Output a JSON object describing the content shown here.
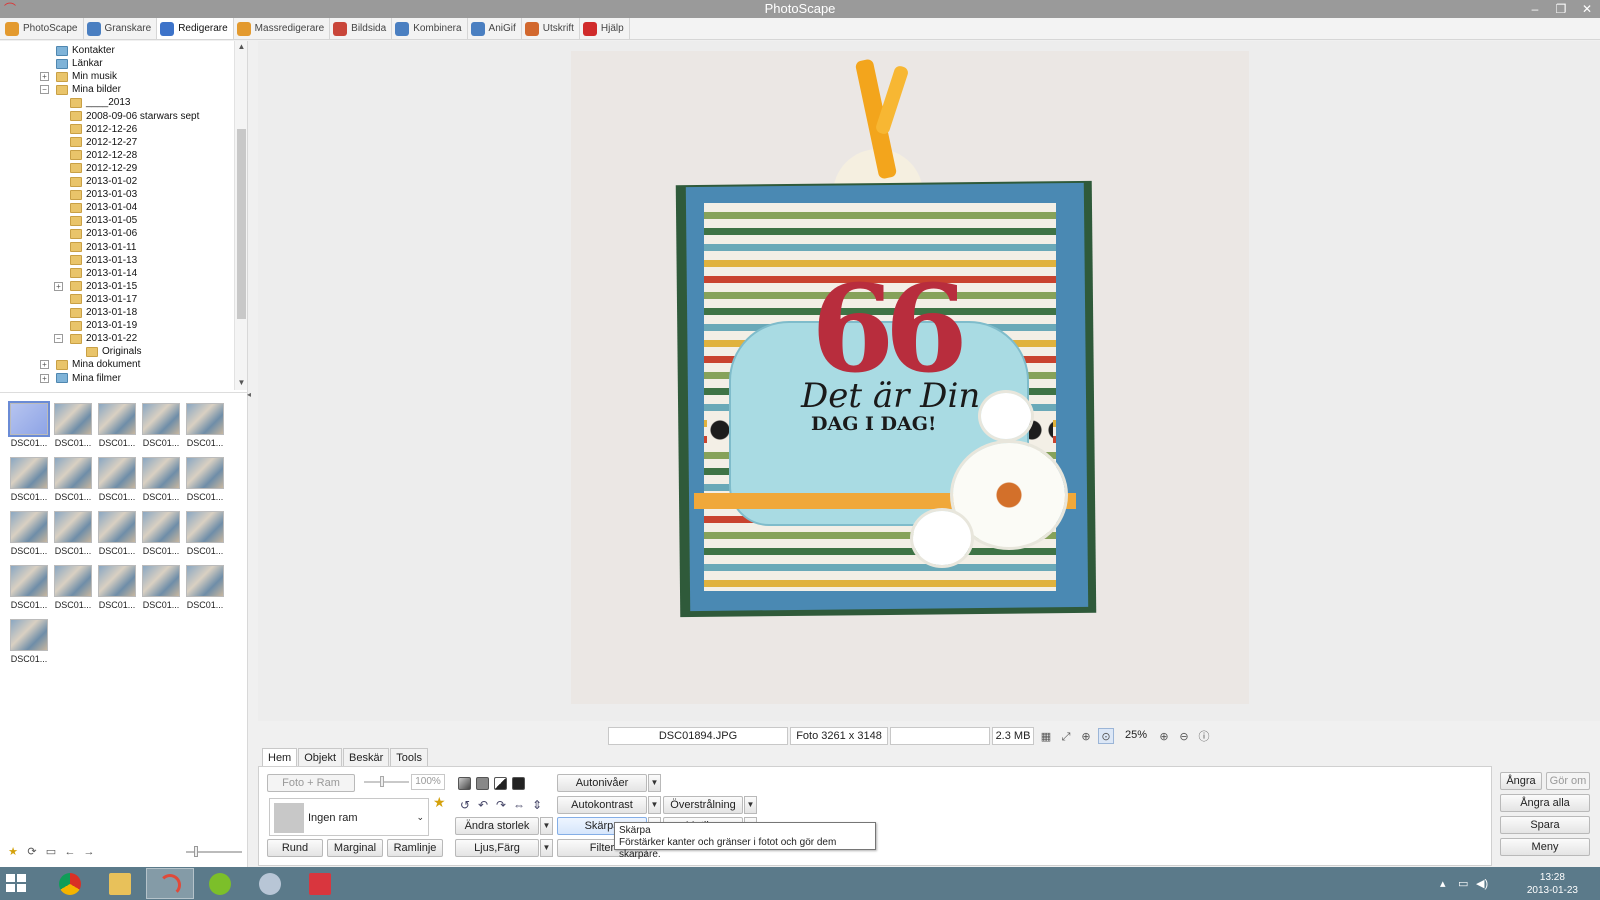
{
  "window": {
    "title": "PhotoScape",
    "controls": [
      "–",
      "❐",
      "✕"
    ]
  },
  "tabs": [
    {
      "label": "PhotoScape",
      "color": "#e39a2f"
    },
    {
      "label": "Granskare",
      "color": "#4a7fc1"
    },
    {
      "label": "Redigerare",
      "color": "#3d73c9",
      "active": true
    },
    {
      "label": "Massredigerare",
      "color": "#e39a2f"
    },
    {
      "label": "Bildsida",
      "color": "#c9463a"
    },
    {
      "label": "Kombinera",
      "color": "#4a7fc1"
    },
    {
      "label": "AniGif",
      "color": "#4a7fc1"
    },
    {
      "label": "Utskrift",
      "color": "#d2682e"
    },
    {
      "label": "Hjälp",
      "color": "#d02b2b"
    }
  ],
  "tree": {
    "items": [
      {
        "label": "Kontakter",
        "level": 1,
        "special": true
      },
      {
        "label": "Länkar",
        "level": 1,
        "special": true
      },
      {
        "label": "Min musik",
        "level": 1,
        "expander": "+"
      },
      {
        "label": "Mina bilder",
        "level": 1,
        "expander": "−"
      },
      {
        "label": "____2013",
        "level": 2
      },
      {
        "label": "2008-09-06 starwars sept",
        "level": 2
      },
      {
        "label": "2012-12-26",
        "level": 2
      },
      {
        "label": "2012-12-27",
        "level": 2
      },
      {
        "label": "2012-12-28",
        "level": 2
      },
      {
        "label": "2012-12-29",
        "level": 2
      },
      {
        "label": "2013-01-02",
        "level": 2
      },
      {
        "label": "2013-01-03",
        "level": 2
      },
      {
        "label": "2013-01-04",
        "level": 2
      },
      {
        "label": "2013-01-05",
        "level": 2
      },
      {
        "label": "2013-01-06",
        "level": 2
      },
      {
        "label": "2013-01-11",
        "level": 2
      },
      {
        "label": "2013-01-13",
        "level": 2
      },
      {
        "label": "2013-01-14",
        "level": 2
      },
      {
        "label": "2013-01-15",
        "level": 2,
        "expander": "+"
      },
      {
        "label": "2013-01-17",
        "level": 2
      },
      {
        "label": "2013-01-18",
        "level": 2
      },
      {
        "label": "2013-01-19",
        "level": 2
      },
      {
        "label": "2013-01-22",
        "level": 2,
        "expander": "−"
      },
      {
        "label": "Originals",
        "level": 3
      },
      {
        "label": "Mina dokument",
        "level": 1,
        "expander": "+"
      },
      {
        "label": "Mina filmer",
        "level": 1,
        "expander": "+",
        "special": true
      }
    ]
  },
  "thumbnails": {
    "caption": "DSC01...",
    "count": 21,
    "selected_index": 0
  },
  "status": {
    "filename": "DSC01894.JPG",
    "dimensions": "Foto 3261 x 3148",
    "filesize": "2.3 MB",
    "zoom": "25%"
  },
  "photo": {
    "number": "66",
    "line1": "Det är Din",
    "line2": "DAG I DAG!"
  },
  "subtabs": [
    "Hem",
    "Objekt",
    "Beskär",
    "Tools"
  ],
  "tools": {
    "foto_ram": "Foto + Ram",
    "opacity": "100%",
    "frame_value": "Ingen ram",
    "rund": "Rund",
    "marginal": "Marginal",
    "ramlinje": "Ramlinje",
    "andra_storlek": "Ändra storlek",
    "ljus_farg": "Ljus,Färg",
    "autonivaer": "Autonivåer",
    "autokontrast": "Autokontrast",
    "skarpa": "Skärpa",
    "filter": "Filter",
    "overstralning": "Överstrålning",
    "motljus": "Motljus"
  },
  "tooltip": {
    "title": "Skärpa",
    "text": "Förstärker kanter och gränser i fotot och gör dem skarpare."
  },
  "actions": {
    "angra": "Ångra",
    "gor_om": "Gör om",
    "angra_alla": "Ångra alla",
    "spara": "Spara",
    "meny": "Meny"
  },
  "taskbar": {
    "time": "13:28",
    "date": "2013-01-23"
  }
}
